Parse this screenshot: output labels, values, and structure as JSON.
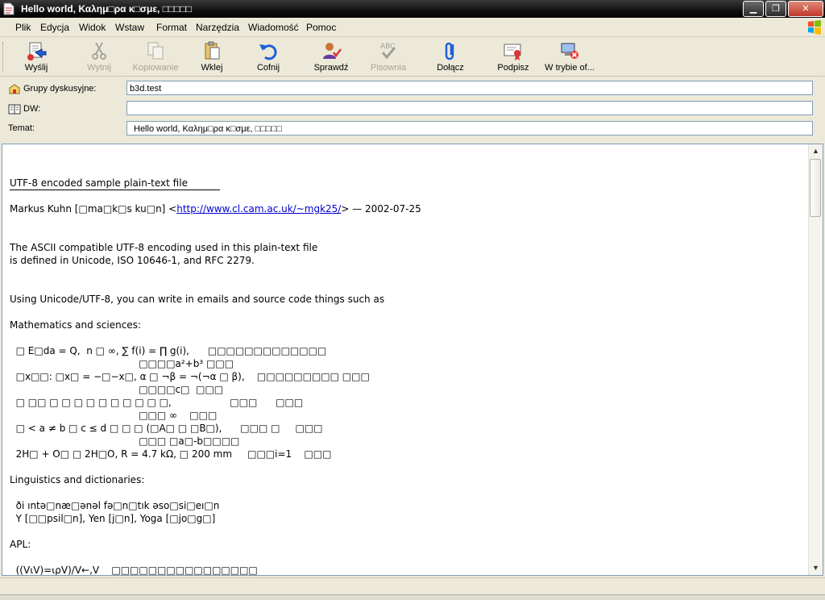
{
  "window": {
    "title": "Hello world, Καλημ□ρα κ□σμε, □□□□□",
    "minimize": "▁",
    "maximize": "❐",
    "close": "✕"
  },
  "menu": [
    "Plik",
    "Edycja",
    "Widok",
    "Wstaw",
    "Format",
    "Narzędzia",
    "Wiadomość",
    "Pomoc"
  ],
  "toolbar": {
    "send": "Wyślij",
    "cut": "Wytnij",
    "copy": "Kopiowanie",
    "paste": "Wklej",
    "undo": "Cofnij",
    "check": "Sprawdź",
    "spelling": "Pisownia",
    "attach": "Dołącz",
    "sign": "Podpisz",
    "offline": "W trybie of..."
  },
  "headers": {
    "newsgroups_label": "Grupy dyskusyjne:",
    "newsgroups_value": "b3d.test",
    "cc_label": "DW:",
    "cc_value": "",
    "subject_label": "Temat:",
    "subject_value": "Hello world, Καλημ□ρα κ□σμε, □□□□□"
  },
  "body": {
    "title": "UTF-8 encoded sample plain-text file",
    "author_prefix": "Markus Kuhn [□ma□k□s ku□n] <",
    "author_link": "http://www.cl.cam.ac.uk/~mgk25/",
    "author_suffix": "> — 2002-07-25",
    "l_ascii1": "The ASCII compatible UTF-8 encoding used in this plain-text file",
    "l_ascii2": "is defined in Unicode, ISO 10646-1, and RFC 2279.",
    "l_using": "Using Unicode/UTF-8, you can write in emails and source code things such as",
    "l_math": "Mathematics and sciences:",
    "m1": "  □ E□da = Q,  n □ ∞, ∑ f(i) = ∏ g(i),      □□□□□□□□□□□□□",
    "m2": "                                          □□□□a²+b³ □□□",
    "m3": "  □x□□: □x□ = −□−x□, α □ ¬β = ¬(¬α □ β),    □□□□□□□□□ □□□",
    "m4": "                                          □□□□c□  □□□",
    "m5": "  □ □□ □ □ □ □ □ □ □ □ □ □,                   □□□      □□□",
    "m6": "                                          □□□ ∞    □□□",
    "m7": "  □ < a ≠ b □ c ≤ d □ □ □ (□A□ □ □B□),      □□□ □     □□□",
    "m8": "                                          □□□ □a□-b□□□□",
    "m9": "  2H□ + O□ □ 2H□O, R = 4.7 kΩ, □ 200 mm     □□□i=1    □□□",
    "l_ling": "Linguistics and dictionaries:",
    "g1": "  ði ıntə□næ□ənəl fə□n□tık əso□si□eı□n",
    "g2": "  Y [□□psil□n], Yen [j□n], Yoga [□jo□g□]",
    "l_apl": "APL:",
    "apl1": "  ((V⍳V)=⍳⍴V)/V←,V    □□□□□□□□□□□□□□□□"
  }
}
